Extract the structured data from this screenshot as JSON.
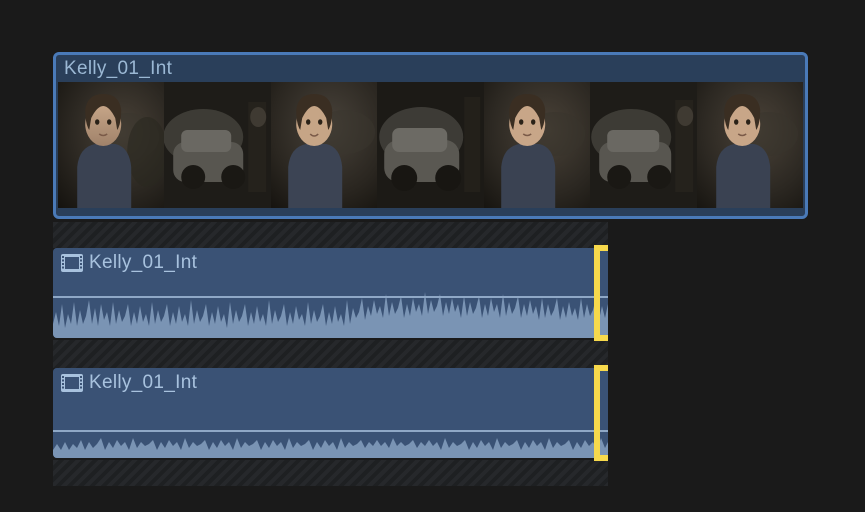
{
  "video_clip": {
    "label": "Kelly_01_Int",
    "thumbnail_count": 7
  },
  "audio_clips": [
    {
      "label": "Kelly_01_Int"
    },
    {
      "label": "Kelly_01_Int"
    }
  ],
  "colors": {
    "clip_bg": "#2a3f5a",
    "clip_border_selected": "#4a7ab8",
    "label_text": "#9bb8d4",
    "edit_bracket": "#f7d94c",
    "waveform": "#8fa8c6"
  }
}
